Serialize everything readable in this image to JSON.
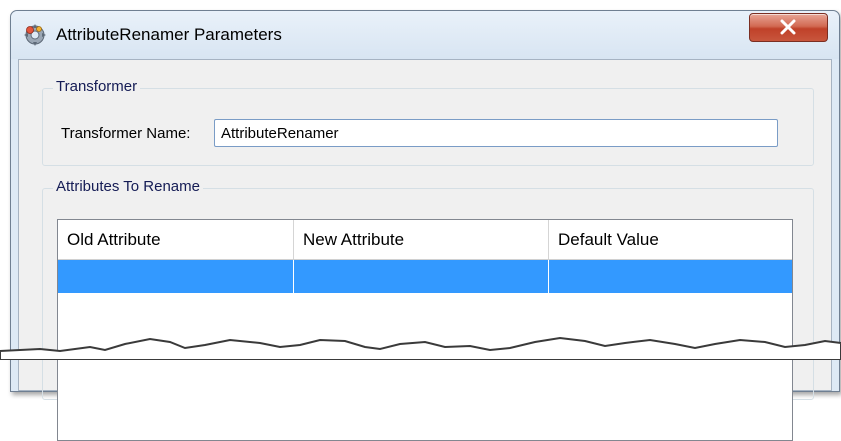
{
  "window": {
    "title": "AttributeRenamer Parameters",
    "icons": {
      "app": "gear-app-icon",
      "close": "close-icon"
    },
    "close_color": "#c8563d"
  },
  "transformer_group": {
    "title": "Transformer",
    "name_label": "Transformer Name:",
    "name_value": "AttributeRenamer"
  },
  "attributes_group": {
    "title": "Attributes To Rename",
    "columns": [
      "Old Attribute",
      "New Attribute",
      "Default Value"
    ],
    "rows": [
      {
        "old": "",
        "new": "",
        "default": "",
        "selected": true
      }
    ],
    "selection_color": "#3399ff"
  }
}
